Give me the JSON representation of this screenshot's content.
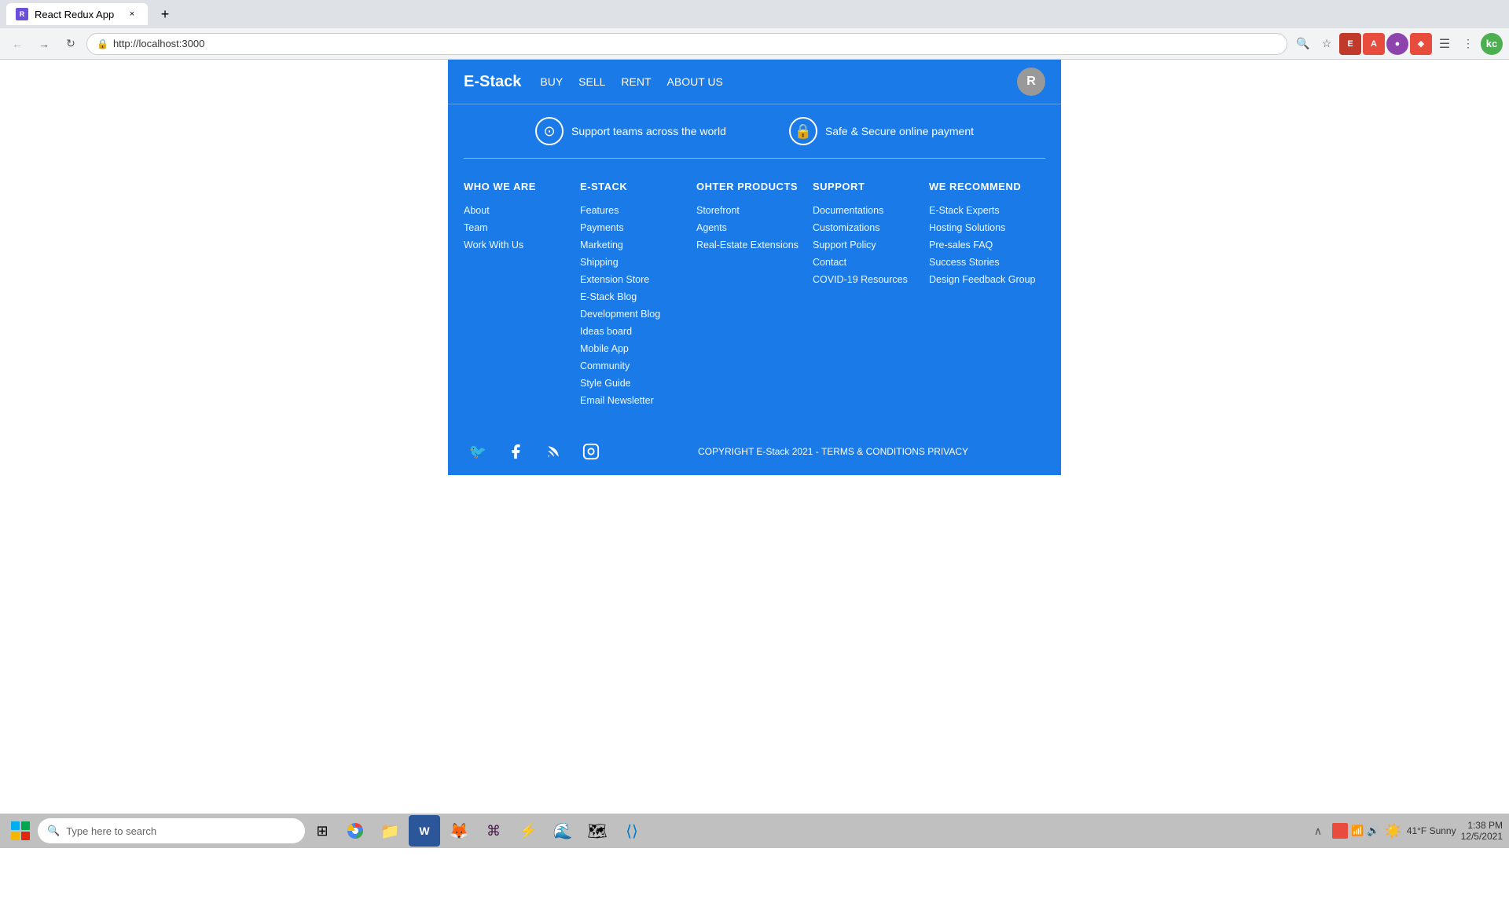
{
  "browser": {
    "tab_title": "React Redux App",
    "tab_new_label": "+",
    "tab_close_label": "×",
    "address": "http://localhost:3000",
    "nav_back_label": "←",
    "nav_forward_label": "→",
    "nav_reload_label": "↻",
    "profile_initial": "kc"
  },
  "site": {
    "logo": "E-Stack",
    "nav": {
      "buy": "BUY",
      "sell": "SELL",
      "rent": "RENT",
      "about_us": "ABOUT US"
    },
    "avatar_initial": "R",
    "info_bar": {
      "support_text": "Support teams across the world",
      "payment_text": "Safe & Secure online payment"
    }
  },
  "footer": {
    "who_we_are": {
      "title": "WHO WE ARE",
      "links": [
        "About",
        "Team",
        "Work With Us"
      ]
    },
    "estack": {
      "title": "E-STACK",
      "links": [
        "Features",
        "Payments",
        "Marketing",
        "Shipping",
        "Extension Store",
        "E-Stack Blog",
        "Development Blog",
        "Ideas board",
        "Mobile App",
        "Community",
        "Style Guide",
        "Email Newsletter"
      ]
    },
    "other_products": {
      "title": "OHTER PRODUCTS",
      "links": [
        "Storefront",
        "Agents",
        "Real-Estate Extensions"
      ]
    },
    "support": {
      "title": "SUPPORT",
      "links": [
        "Documentations",
        "Customizations",
        "Support Policy",
        "Contact",
        "COVID-19 Resources"
      ]
    },
    "we_recommend": {
      "title": "WE RECOMMEND",
      "links": [
        "E-Stack Experts",
        "Hosting Solutions",
        "Pre-sales FAQ",
        "Success Stories",
        "Design Feedback Group"
      ]
    },
    "copyright": "COPYRIGHT E-Stack 2021 - TERMS & CONDITIONS  PRIVACY"
  },
  "taskbar": {
    "search_placeholder": "Type here to search",
    "weather": "41°F  Sunny",
    "time": "1:38 PM",
    "date": "12/5/2021"
  }
}
